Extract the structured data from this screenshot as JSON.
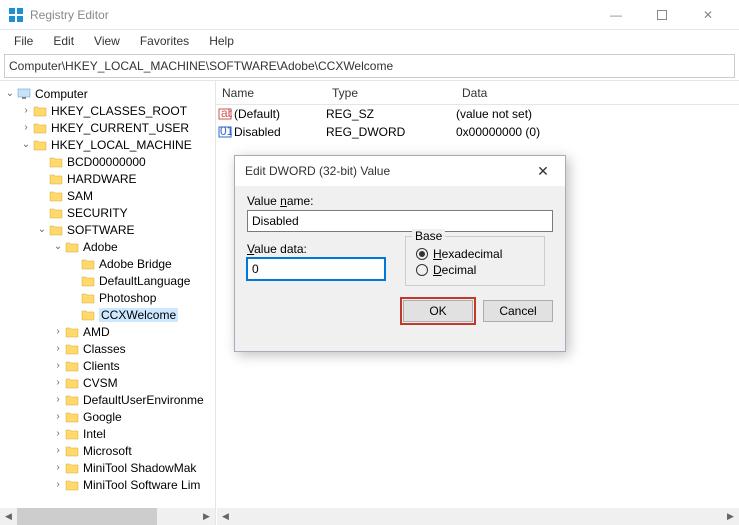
{
  "window": {
    "title": "Registry Editor"
  },
  "menu": [
    "File",
    "Edit",
    "View",
    "Favorites",
    "Help"
  ],
  "address": "Computer\\HKEY_LOCAL_MACHINE\\SOFTWARE\\Adobe\\CCXWelcome",
  "tree": [
    {
      "indent": 0,
      "exp": "expanded",
      "icon": "pc",
      "label": "Computer"
    },
    {
      "indent": 1,
      "exp": "collapsed",
      "icon": "folder",
      "label": "HKEY_CLASSES_ROOT"
    },
    {
      "indent": 1,
      "exp": "collapsed",
      "icon": "folder",
      "label": "HKEY_CURRENT_USER"
    },
    {
      "indent": 1,
      "exp": "expanded",
      "icon": "folder",
      "label": "HKEY_LOCAL_MACHINE"
    },
    {
      "indent": 2,
      "exp": "none",
      "icon": "folder",
      "label": "BCD00000000"
    },
    {
      "indent": 2,
      "exp": "none",
      "icon": "folder",
      "label": "HARDWARE"
    },
    {
      "indent": 2,
      "exp": "none",
      "icon": "folder",
      "label": "SAM"
    },
    {
      "indent": 2,
      "exp": "none",
      "icon": "folder",
      "label": "SECURITY"
    },
    {
      "indent": 2,
      "exp": "expanded",
      "icon": "folder",
      "label": "SOFTWARE"
    },
    {
      "indent": 3,
      "exp": "expanded",
      "icon": "folder",
      "label": "Adobe"
    },
    {
      "indent": 4,
      "exp": "none",
      "icon": "folder",
      "label": "Adobe Bridge"
    },
    {
      "indent": 4,
      "exp": "none",
      "icon": "folder",
      "label": "DefaultLanguage"
    },
    {
      "indent": 4,
      "exp": "none",
      "icon": "folder",
      "label": "Photoshop"
    },
    {
      "indent": 4,
      "exp": "none",
      "icon": "folder",
      "label": "CCXWelcome",
      "selected": true
    },
    {
      "indent": 3,
      "exp": "collapsed",
      "icon": "folder",
      "label": "AMD"
    },
    {
      "indent": 3,
      "exp": "collapsed",
      "icon": "folder",
      "label": "Classes"
    },
    {
      "indent": 3,
      "exp": "collapsed",
      "icon": "folder",
      "label": "Clients"
    },
    {
      "indent": 3,
      "exp": "collapsed",
      "icon": "folder",
      "label": "CVSM"
    },
    {
      "indent": 3,
      "exp": "collapsed",
      "icon": "folder",
      "label": "DefaultUserEnvironme"
    },
    {
      "indent": 3,
      "exp": "collapsed",
      "icon": "folder",
      "label": "Google"
    },
    {
      "indent": 3,
      "exp": "collapsed",
      "icon": "folder",
      "label": "Intel"
    },
    {
      "indent": 3,
      "exp": "collapsed",
      "icon": "folder",
      "label": "Microsoft"
    },
    {
      "indent": 3,
      "exp": "collapsed",
      "icon": "folder",
      "label": "MiniTool ShadowMak"
    },
    {
      "indent": 3,
      "exp": "collapsed",
      "icon": "folder",
      "label": "MiniTool Software Lim"
    }
  ],
  "list": {
    "headers": {
      "name": "Name",
      "type": "Type",
      "data": "Data"
    },
    "rows": [
      {
        "icon": "sz",
        "name": "(Default)",
        "type": "REG_SZ",
        "data": "(value not set)"
      },
      {
        "icon": "dw",
        "name": "Disabled",
        "type": "REG_DWORD",
        "data": "0x00000000 (0)"
      }
    ]
  },
  "dialog": {
    "title": "Edit DWORD (32-bit) Value",
    "value_name_label": "Value name:",
    "value_name": "Disabled",
    "value_data_label": "Value data:",
    "value_data": "0",
    "base_label": "Base",
    "hex_label": "Hexadecimal",
    "dec_label": "Decimal",
    "ok": "OK",
    "cancel": "Cancel"
  }
}
